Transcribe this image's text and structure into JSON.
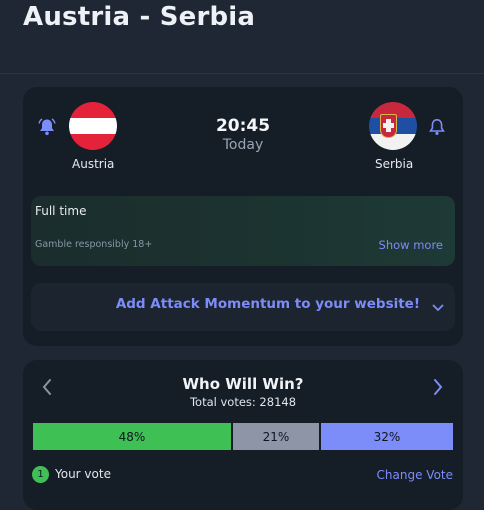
{
  "page": {
    "title": "Austria - Serbia"
  },
  "match": {
    "home": {
      "name": "Austria",
      "flag_icon": "austria-flag-icon"
    },
    "away": {
      "name": "Serbia",
      "flag_icon": "serbia-flag-icon"
    },
    "time": "20:45",
    "day": "Today",
    "status": "Full time",
    "gamble_notice": "Gamble responsibly 18+",
    "show_more_label": "Show more",
    "promo_label": "Add Attack Momentum to your website!"
  },
  "vote": {
    "title": "Who Will Win?",
    "total_label": "Total votes: 28148",
    "options": [
      {
        "key": "home",
        "percent": 48,
        "label": "48%",
        "color": "#3fc054"
      },
      {
        "key": "draw",
        "percent": 21,
        "label": "21%",
        "color": "#8d95a6"
      },
      {
        "key": "away",
        "percent": 32,
        "label": "32%",
        "color": "#7c8cf8"
      }
    ],
    "badge": "1",
    "your_vote_label": "Your vote",
    "change_vote_label": "Change Vote"
  },
  "colors": {
    "accent": "#7c8cf8",
    "home": "#3fc054",
    "background": "#1e2733",
    "card": "#151d27"
  }
}
